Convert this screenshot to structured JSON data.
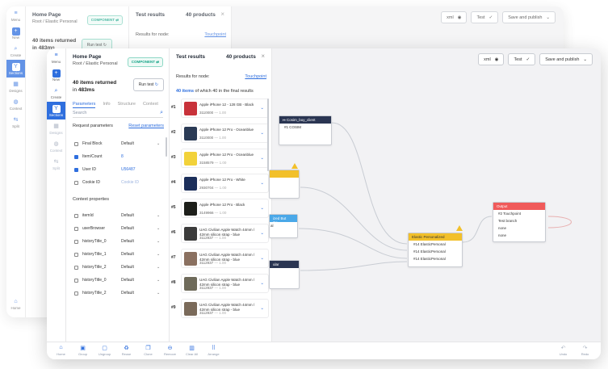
{
  "iconbar": {
    "items": [
      {
        "label": "Menu",
        "icon": "menu-icon"
      },
      {
        "label": "New",
        "icon": "plus-icon"
      },
      {
        "label": "Create",
        "icon": "search-icon"
      },
      {
        "label": "Sections",
        "icon": "branch-icon",
        "active": true
      },
      {
        "label": "Designs",
        "icon": "image-icon"
      },
      {
        "label": "Context",
        "icon": "globe-icon"
      },
      {
        "label": "Split",
        "icon": "split-icon"
      }
    ],
    "home_label": "Home"
  },
  "panel": {
    "title": "Home Page",
    "breadcrumb": "Root / Elastic Personal",
    "badge": "COMPONENT",
    "returned_line1": "40 items returned",
    "returned_prefix": "in ",
    "returned_ms": "483ms",
    "run_button": "Run test",
    "tabs": [
      "Parameters",
      "Info",
      "Structure",
      "Context"
    ],
    "search_placeholder": "Search",
    "request_title": "Request parameters",
    "reset_link": "Reset parameters",
    "request_params": [
      {
        "label": "Final Block",
        "value": "Default",
        "checked": false,
        "kind": "dropdown"
      },
      {
        "label": "Item/Count",
        "value": "8",
        "checked": true,
        "kind": "link"
      },
      {
        "label": "User ID",
        "value": "U56487",
        "checked": true,
        "kind": "link"
      },
      {
        "label": "Cookie ID",
        "value": "Cookie ID",
        "checked": false,
        "kind": "placeholder"
      }
    ],
    "context_title": "Context properties",
    "context_params": [
      {
        "label": "itemId",
        "value": "Default"
      },
      {
        "label": "userBrowser",
        "value": "Default"
      },
      {
        "label": "historyTitle_0",
        "value": "Default"
      },
      {
        "label": "historyTitle_1",
        "value": "Default"
      },
      {
        "label": "historyTitle_2",
        "value": "Default"
      },
      {
        "label": "historyTitle_0",
        "value": "Default"
      },
      {
        "label": "historyTitle_2",
        "value": "Default"
      }
    ]
  },
  "results": {
    "title": "Test results",
    "count": "40 products",
    "node_label": "Results for node:",
    "node_link": "Touchpoint",
    "summary_bold": "40 items",
    "summary_rest": " of which 40 in the final results",
    "items": [
      {
        "num": "#1",
        "name": "Apple iPhone 12 - 128 GB - Black",
        "sku": "3110000",
        "score": "1.00",
        "color": "#c8323a"
      },
      {
        "num": "#2",
        "name": "Apple iPhone 12 Pro - Oceanblue",
        "sku": "3110000",
        "score": "1.00",
        "color": "#2a3a55"
      },
      {
        "num": "#3",
        "name": "Apple iPhone 12 Pro - Oceanblue",
        "sku": "3158579",
        "score": "1.00",
        "color": "#f2d23a"
      },
      {
        "num": "#4",
        "name": "Apple iPhone 12 Pro - White",
        "sku": "2930704",
        "score": "1.00",
        "color": "#1b2e5a"
      },
      {
        "num": "#5",
        "name": "Apple iPhone 12 Pro - Black",
        "sku": "3149966",
        "score": "1.00",
        "color": "#1d1f1a"
      },
      {
        "num": "#6",
        "name": "UAG Civilian Apple Watch 44mm / 42mm silicon strap - blue",
        "sku": "3112937",
        "score": "1.00",
        "color": "#3b3b3b"
      },
      {
        "num": "#7",
        "name": "UAG Civilian Apple Watch 44mm / 42mm silicon strap - blue",
        "sku": "3112937",
        "score": "1.00",
        "color": "#8a7060"
      },
      {
        "num": "#8",
        "name": "UAG Civilian Apple Watch 44mm / 42mm silicon strap - blue",
        "sku": "3112937",
        "score": "1.00",
        "color": "#6e6a5a"
      },
      {
        "num": "#9",
        "name": "UAG Civilian Apple Watch 44mm / 42mm silicon strap - blue",
        "sku": "3112937",
        "score": "1.00",
        "color": "#7a6a5a"
      }
    ]
  },
  "toolbar": {
    "xml": "xml",
    "test": "Test",
    "publish": "Save and publish"
  },
  "nodes": {
    "cosim": {
      "title": "Cosim_buy_client",
      "row": "#1 COSIM",
      "color": "#2a3552"
    },
    "personalized": {
      "title": "Elastic Personalized",
      "rows": [
        "#14 ElasticPersonal",
        "#14 ElasticPersonal",
        "#14 ElasticPersonal"
      ],
      "color": "#f2c02a"
    },
    "output": {
      "title": "Output",
      "rows": [
        "#2 Touchpoint",
        "Test branch",
        "none",
        "none"
      ],
      "color": "#f05a5a"
    },
    "left_partial_1": {
      "color": "#f2c02a"
    },
    "left_partial_2": {
      "title": "ized But Co...",
      "row": "al",
      "color": "#4aa8e8"
    },
    "left_partial_3": {
      "title": "ular",
      "color": "#2a3552"
    }
  },
  "footer": {
    "items": [
      {
        "label": "Home",
        "icon": "home-icon"
      },
      {
        "label": "Group",
        "icon": "group-icon"
      },
      {
        "label": "Ungroup",
        "icon": "ungroup-icon"
      },
      {
        "label": "Reuse",
        "icon": "reuse-icon"
      },
      {
        "label": "Clone",
        "icon": "clone-icon"
      },
      {
        "label": "Remove",
        "icon": "remove-icon"
      },
      {
        "label": "Clear All",
        "icon": "trash-icon"
      },
      {
        "label": "Arrange",
        "icon": "arrange-icon"
      },
      {
        "label": "Undo",
        "icon": "undo-icon"
      },
      {
        "label": "Redo",
        "icon": "redo-icon"
      }
    ]
  }
}
